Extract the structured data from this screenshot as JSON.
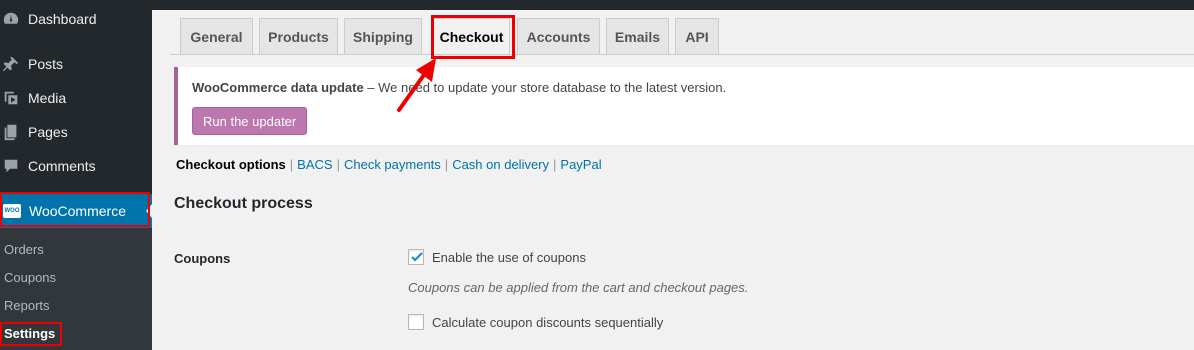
{
  "sidebar": {
    "items": [
      {
        "label": "Dashboard",
        "icon": "dashboard-icon"
      },
      {
        "label": "Posts",
        "icon": "pin-icon"
      },
      {
        "label": "Media",
        "icon": "media-icon"
      },
      {
        "label": "Pages",
        "icon": "pages-icon"
      },
      {
        "label": "Comments",
        "icon": "comment-icon"
      }
    ],
    "woocommerce": {
      "label": "WooCommerce",
      "badge": "WOO"
    },
    "submenu": [
      "Orders",
      "Coupons",
      "Reports",
      "Settings"
    ]
  },
  "tabs": [
    "General",
    "Products",
    "Shipping",
    "Checkout",
    "Accounts",
    "Emails",
    "API"
  ],
  "active_tab": "Checkout",
  "notice": {
    "title": "WooCommerce data update",
    "text": " – We need to update your store database to the latest version.",
    "button": "Run the updater"
  },
  "subsections": {
    "current": "Checkout options",
    "links": [
      "BACS",
      "Check payments",
      "Cash on delivery",
      "PayPal"
    ]
  },
  "section_title": "Checkout process",
  "coupons": {
    "label": "Coupons",
    "option1": {
      "label": "Enable the use of coupons",
      "checked": true
    },
    "option1_desc": "Coupons can be applied from the cart and checkout pages.",
    "option2": {
      "label": "Calculate coupon discounts sequentially",
      "checked": false
    }
  },
  "colors": {
    "admin_bar": "#23282d",
    "woo_active": "#0073aa",
    "woo_button": "#bb77ae",
    "highlight": "#e00000",
    "link": "#0073aa"
  }
}
